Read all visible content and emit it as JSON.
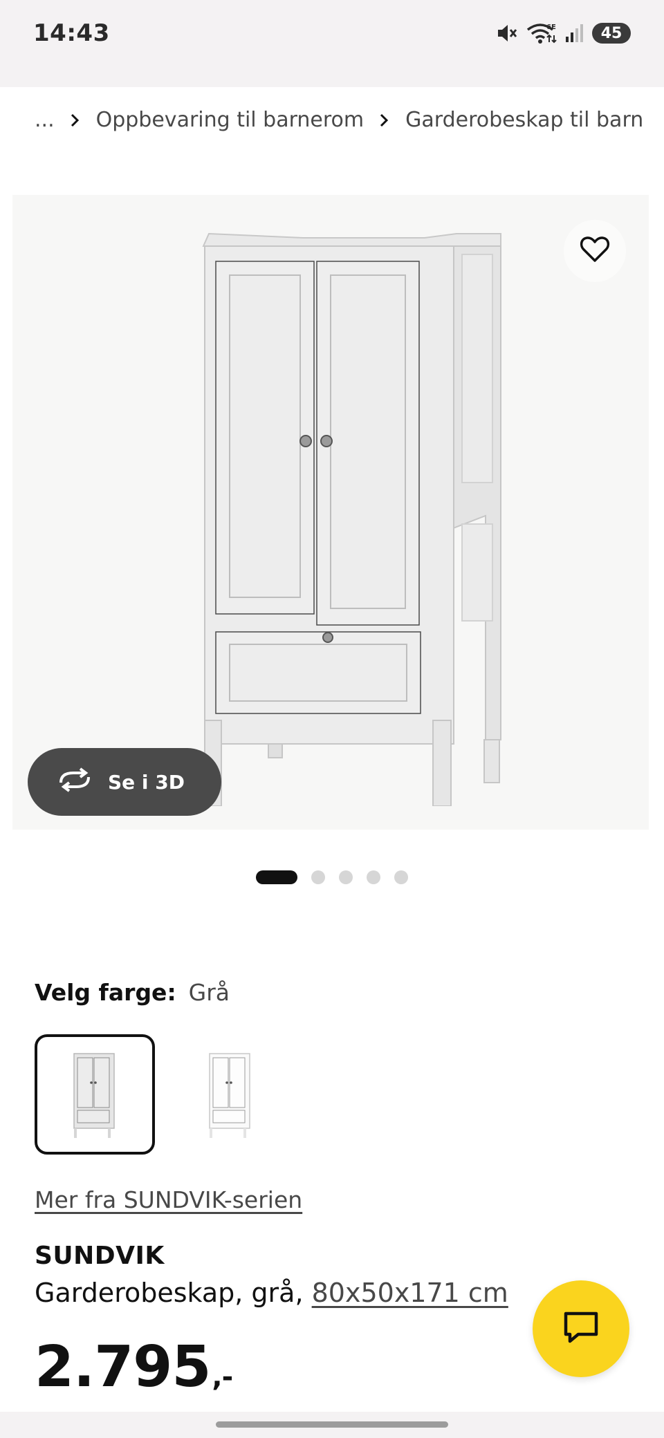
{
  "status_bar": {
    "time": "14:43",
    "battery": "45",
    "icons": [
      "mute-icon",
      "wifi-6e-icon",
      "signal-icon"
    ]
  },
  "breadcrumb": {
    "ellipsis": "...",
    "items": [
      "Oppbevaring til barnerom",
      "Garderobeskap til barn"
    ]
  },
  "gallery": {
    "view_3d_label": "Se i 3D",
    "image_count": 5,
    "active_index": 0
  },
  "color_selector": {
    "label": "Velg farge:",
    "selected_value": "Grå",
    "options": [
      "gray",
      "white"
    ]
  },
  "series_link": "Mer fra SUNDVIK-serien",
  "product": {
    "name": "SUNDVIK",
    "description": "Garderobeskap, grå, ",
    "dimensions": "80x50x171 cm",
    "price": "2.795",
    "price_suffix": ",-"
  },
  "colors": {
    "accent_yellow": "#fad41e",
    "dark_button": "#4a4a4a",
    "text_primary": "#111111",
    "text_secondary": "#484848"
  }
}
